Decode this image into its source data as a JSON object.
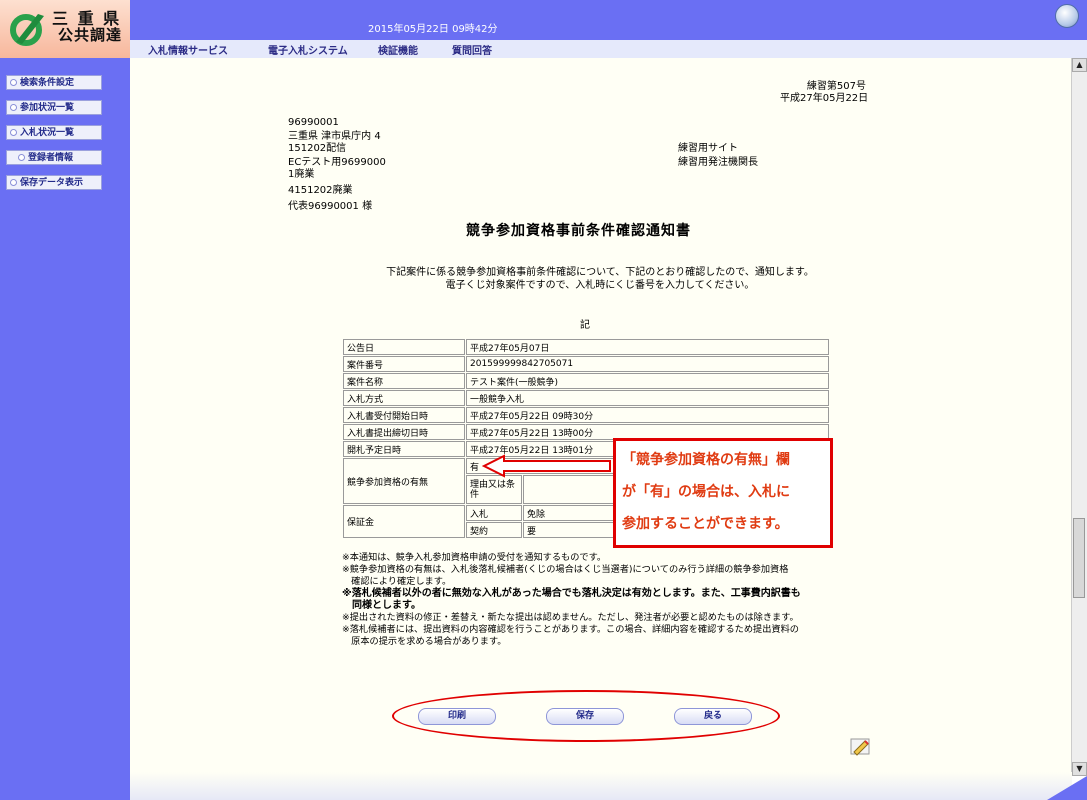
{
  "logo": {
    "line1": "三 重 県",
    "line2": "公共調達"
  },
  "header": {
    "datetime": "2015年05月22日 09時42分"
  },
  "menu": [
    {
      "label": "入札情報サービス"
    },
    {
      "label": "電子入札システム"
    },
    {
      "label": "検証機能"
    },
    {
      "label": "質問回答"
    }
  ],
  "sidebar": [
    {
      "label": "検索条件設定"
    },
    {
      "label": "参加状況一覧"
    },
    {
      "label": "入札状況一覧"
    },
    {
      "label": "登録者情報"
    },
    {
      "label": "保存データ表示"
    }
  ],
  "doc": {
    "number": "練習第507号",
    "date": "平成27年05月22日",
    "recipient": [
      "96990001",
      "三重県 津市県庁内 4",
      "151202配信",
      "ECテスト用9699000",
      "1廃業",
      "4151202廃業",
      "代表96990001 様"
    ],
    "sender": [
      "練習用サイト",
      "練習用発注機関長"
    ],
    "title": "競争参加資格事前条件確認通知書",
    "intro1": "下記案件に係る競争参加資格事前条件確認について、下記のとおり確認したので、通知します。",
    "intro2": "電子くじ対象案件ですので、入札時にくじ番号を入力してください。",
    "ki": "記"
  },
  "table": {
    "rows": [
      {
        "label": "公告日",
        "value": "平成27年05月07日"
      },
      {
        "label": "案件番号",
        "value": "2015999998427050​71"
      },
      {
        "label": "案件名称",
        "value": "テスト案件(一般競争)"
      },
      {
        "label": "入札方式",
        "value": "一般競争入札"
      },
      {
        "label": "入札書受付開始日時",
        "value": "平成27年05月22日 09時30分"
      },
      {
        "label": "入札書提出締切日時",
        "value": "平成27年05月22日 13時00分"
      },
      {
        "label": "開札予定日時",
        "value": "平成27年05月22日 13時01分"
      }
    ],
    "qualification": {
      "label": "競争参加資格の有無",
      "value": "有",
      "reason_label": "理由又は条件",
      "reason_value": ""
    },
    "deposit": {
      "label": "保証金",
      "bid_label": "入札",
      "bid_value": "免除",
      "contract_label": "契約",
      "contract_value": "要"
    }
  },
  "notes": [
    "※本通知は、競争入札参加資格申請の受付を通知するものです。",
    "※競争参加資格の有無は、入札後落札候補者(くじの場合はくじ当選者)についてのみ行う詳細の競争参加資格",
    "　確認により確定します。",
    "※落札候補者以外の者に無効な入札があった場合でも落札決定は有効とします。また、工事費内訳書も",
    "　同様とします。",
    "※提出された資料の修正・差替え・新たな提出は認めません。ただし、発注者が必要と認めたものは除きます。",
    "※落札候補者には、提出資料の内容確認を行うことがあります。この場合、詳細内容を確認するため提出資料の",
    "　原本の提示を求める場合があります。"
  ],
  "callout": [
    "「競争参加資格の有無」欄",
    "が「有」の場合は、入札に",
    "参加することができます。"
  ],
  "buttons": {
    "print": "印刷",
    "save": "保存",
    "back": "戻る"
  },
  "colors": {
    "accent": "#6a6ff3",
    "highlight": "#e00000",
    "callout_text": "#e03b12"
  }
}
